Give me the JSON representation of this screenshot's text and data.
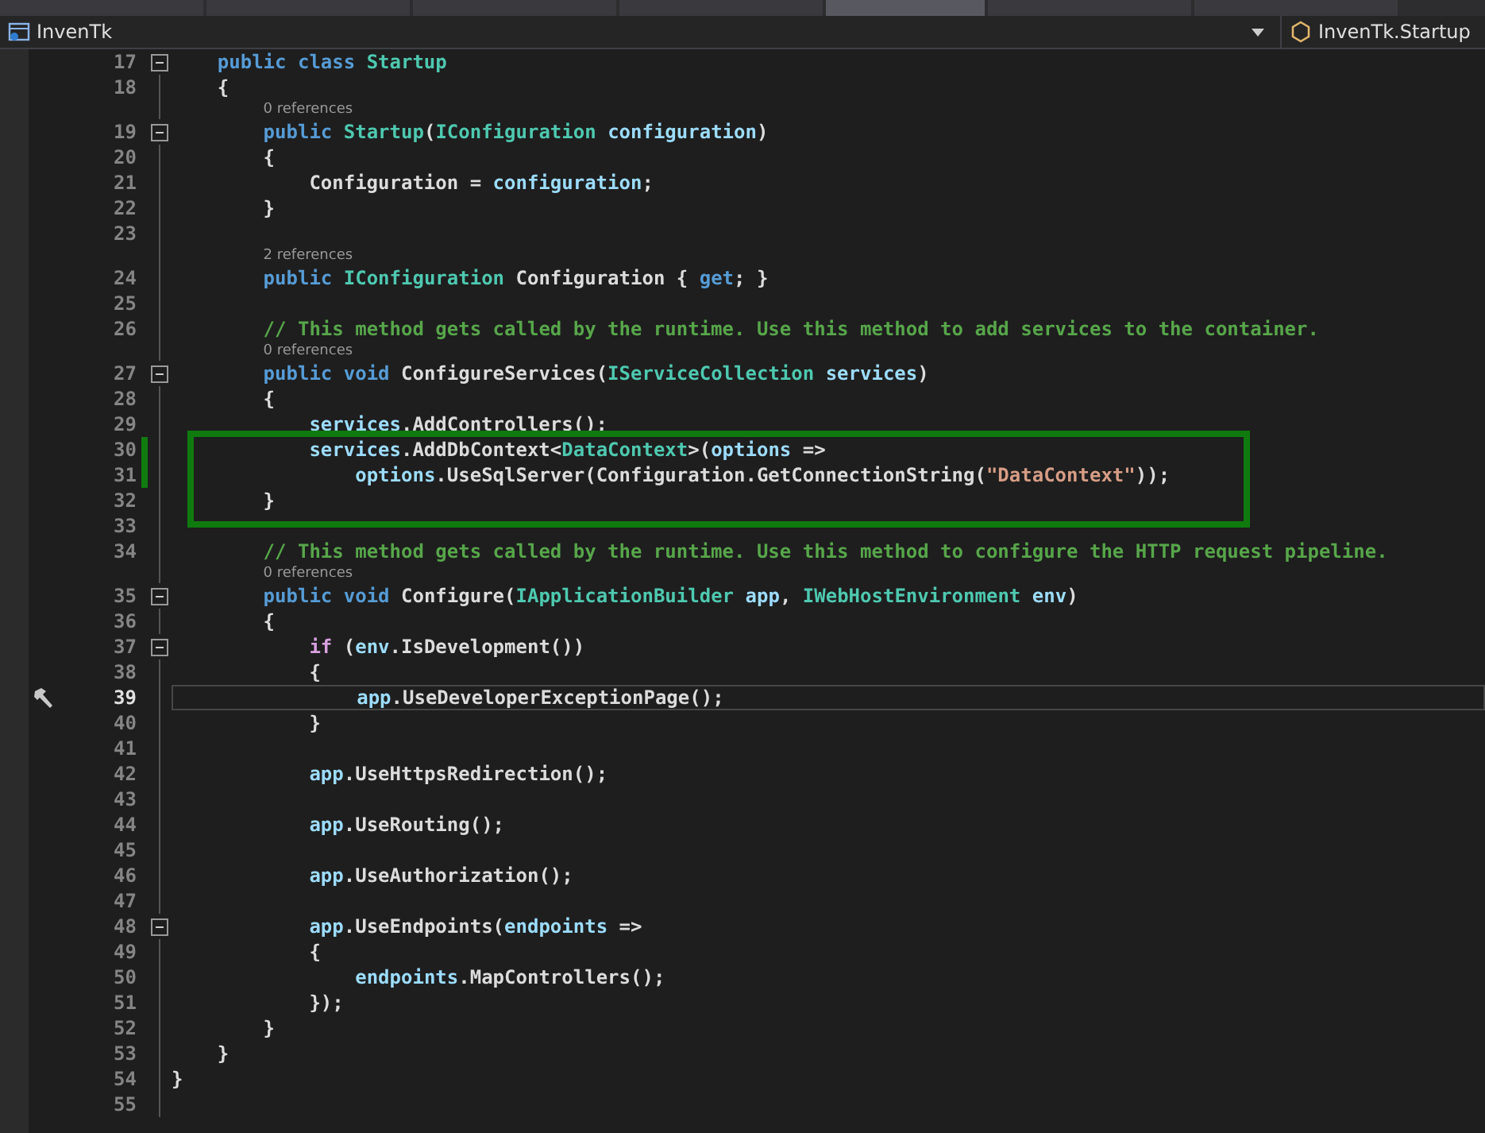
{
  "navbar": {
    "project": "InvenTk",
    "member": "InvenTk.Startup"
  },
  "lines": [
    {
      "children": [
        {
          "number": "17",
          "fold": true,
          "tokens": [
            {
              "kind": "kw",
              "text": "public class "
            },
            {
              "kind": "type",
              "text": "Startup"
            }
          ]
        },
        {
          "number": "18",
          "tokens": [
            {
              "kind": "plain",
              "text": "{"
            }
          ]
        },
        {
          "children": [
            {
              "lens": "0 references"
            },
            {
              "number": "19",
              "fold": true,
              "tokens": [
                {
                  "kind": "kw",
                  "text": "public "
                },
                {
                  "kind": "type",
                  "text": "Startup"
                },
                {
                  "kind": "plain",
                  "text": "("
                },
                {
                  "kind": "type",
                  "text": "IConfiguration "
                },
                {
                  "kind": "var",
                  "text": "configuration"
                },
                {
                  "kind": "plain",
                  "text": ")"
                }
              ]
            },
            {
              "number": "20",
              "tokens": [
                {
                  "kind": "plain",
                  "text": "{"
                }
              ],
              "children": [
                {
                  "number": "21",
                  "tokens": [
                    {
                      "kind": "plain",
                      "text": "Configuration = "
                    },
                    {
                      "kind": "var",
                      "text": "configuration"
                    },
                    {
                      "kind": "plain",
                      "text": ";"
                    }
                  ]
                }
              ]
            },
            {
              "number": "22",
              "tokens": [
                {
                  "kind": "plain",
                  "text": "}"
                }
              ]
            },
            {
              "number": "23"
            },
            {
              "lens": "2 references"
            },
            {
              "number": "24",
              "tokens": [
                {
                  "kind": "kw",
                  "text": "public "
                },
                {
                  "kind": "type",
                  "text": "IConfiguration "
                },
                {
                  "kind": "plain",
                  "text": "Configuration { "
                },
                {
                  "kind": "kw",
                  "text": "get"
                },
                {
                  "kind": "plain",
                  "text": "; }"
                }
              ]
            },
            {
              "number": "25"
            },
            {
              "number": "26",
              "tokens": [
                {
                  "kind": "comment",
                  "text": "// This method gets called by the runtime. Use this method to add services to the container."
                }
              ]
            },
            {
              "lens": "0 references"
            },
            {
              "number": "27",
              "fold": true,
              "tokens": [
                {
                  "kind": "kw",
                  "text": "public void "
                },
                {
                  "kind": "plain",
                  "text": "ConfigureServices("
                },
                {
                  "kind": "type",
                  "text": "IServiceCollection "
                },
                {
                  "kind": "var",
                  "text": "services"
                },
                {
                  "kind": "plain",
                  "text": ")"
                }
              ]
            },
            {
              "number": "28",
              "tokens": [
                {
                  "kind": "plain",
                  "text": "{"
                }
              ],
              "children": [
                {
                  "number": "29",
                  "tokens": [
                    {
                      "kind": "var",
                      "text": "services"
                    },
                    {
                      "kind": "plain",
                      "text": ".AddControllers();"
                    }
                  ]
                },
                {
                  "number": "30",
                  "changed": true,
                  "tokens": [
                    {
                      "kind": "var",
                      "text": "services"
                    },
                    {
                      "kind": "plain",
                      "text": ".AddDbContext<"
                    },
                    {
                      "kind": "type",
                      "text": "DataContext"
                    },
                    {
                      "kind": "plain",
                      "text": ">("
                    },
                    {
                      "kind": "var",
                      "text": "options"
                    },
                    {
                      "kind": "plain",
                      "text": " =>"
                    }
                  ],
                  "children": [
                    {
                      "number": "31",
                      "changed": true,
                      "tokens": [
                        {
                          "kind": "var",
                          "text": "options"
                        },
                        {
                          "kind": "plain",
                          "text": ".UseSqlServer(Configuration.GetConnectionString("
                        },
                        {
                          "kind": "str",
                          "text": "\"DataContext\""
                        },
                        {
                          "kind": "plain",
                          "text": "));"
                        }
                      ]
                    }
                  ]
                }
              ]
            },
            {
              "number": "32",
              "tokens": [
                {
                  "kind": "plain",
                  "text": "}"
                }
              ]
            },
            {
              "number": "33"
            },
            {
              "number": "34",
              "tokens": [
                {
                  "kind": "comment",
                  "text": "// This method gets called by the runtime. Use this method to configure the HTTP request pipeline."
                }
              ]
            },
            {
              "lens": "0 references"
            },
            {
              "number": "35",
              "fold": true,
              "tokens": [
                {
                  "kind": "kw",
                  "text": "public void "
                },
                {
                  "kind": "plain",
                  "text": "Configure("
                },
                {
                  "kind": "type",
                  "text": "IApplicationBuilder "
                },
                {
                  "kind": "var",
                  "text": "app"
                },
                {
                  "kind": "plain",
                  "text": ", "
                },
                {
                  "kind": "type",
                  "text": "IWebHostEnvironment "
                },
                {
                  "kind": "var",
                  "text": "env"
                },
                {
                  "kind": "plain",
                  "text": ")"
                }
              ]
            },
            {
              "number": "36",
              "tokens": [
                {
                  "kind": "plain",
                  "text": "{"
                }
              ],
              "children": [
                {
                  "number": "37",
                  "fold": true,
                  "tokens": [
                    {
                      "kind": "ctl",
                      "text": "if"
                    },
                    {
                      "kind": "plain",
                      "text": " ("
                    },
                    {
                      "kind": "var",
                      "text": "env"
                    },
                    {
                      "kind": "plain",
                      "text": ".IsDevelopment())"
                    }
                  ]
                },
                {
                  "number": "38",
                  "tokens": [
                    {
                      "kind": "plain",
                      "text": "{"
                    }
                  ],
                  "children": [
                    {
                      "number": "39",
                      "current": true,
                      "build_marker": true,
                      "tokens": [
                        {
                          "kind": "var",
                          "text": "app"
                        },
                        {
                          "kind": "plain",
                          "text": ".UseDeveloperExceptionPage();"
                        }
                      ]
                    }
                  ]
                },
                {
                  "number": "40",
                  "tokens": [
                    {
                      "kind": "plain",
                      "text": "}"
                    }
                  ]
                },
                {
                  "number": "41"
                },
                {
                  "number": "42",
                  "tokens": [
                    {
                      "kind": "var",
                      "text": "app"
                    },
                    {
                      "kind": "plain",
                      "text": ".UseHttpsRedirection();"
                    }
                  ]
                },
                {
                  "number": "43"
                },
                {
                  "number": "44",
                  "tokens": [
                    {
                      "kind": "var",
                      "text": "app"
                    },
                    {
                      "kind": "plain",
                      "text": ".UseRouting();"
                    }
                  ]
                },
                {
                  "number": "45"
                },
                {
                  "number": "46",
                  "tokens": [
                    {
                      "kind": "var",
                      "text": "app"
                    },
                    {
                      "kind": "plain",
                      "text": ".UseAuthorization();"
                    }
                  ]
                },
                {
                  "number": "47"
                },
                {
                  "number": "48",
                  "fold": true,
                  "tokens": [
                    {
                      "kind": "var",
                      "text": "app"
                    },
                    {
                      "kind": "plain",
                      "text": ".UseEndpoints("
                    },
                    {
                      "kind": "var",
                      "text": "endpoints"
                    },
                    {
                      "kind": "plain",
                      "text": " =>"
                    }
                  ]
                },
                {
                  "number": "49",
                  "tokens": [
                    {
                      "kind": "plain",
                      "text": "{"
                    }
                  ],
                  "children": [
                    {
                      "number": "50",
                      "tokens": [
                        {
                          "kind": "var",
                          "text": "endpoints"
                        },
                        {
                          "kind": "plain",
                          "text": ".MapControllers();"
                        }
                      ]
                    }
                  ]
                },
                {
                  "number": "51",
                  "tokens": [
                    {
                      "kind": "plain",
                      "text": "});"
                    }
                  ]
                }
              ]
            },
            {
              "number": "52",
              "tokens": [
                {
                  "kind": "plain",
                  "text": "}"
                }
              ]
            }
          ]
        },
        {
          "number": "53",
          "tokens": [
            {
              "kind": "plain",
              "text": "}"
            }
          ]
        }
      ]
    },
    {
      "number": "54",
      "tokens": [
        {
          "kind": "plain",
          "text": "}"
        }
      ]
    },
    {
      "number": "55"
    }
  ]
}
